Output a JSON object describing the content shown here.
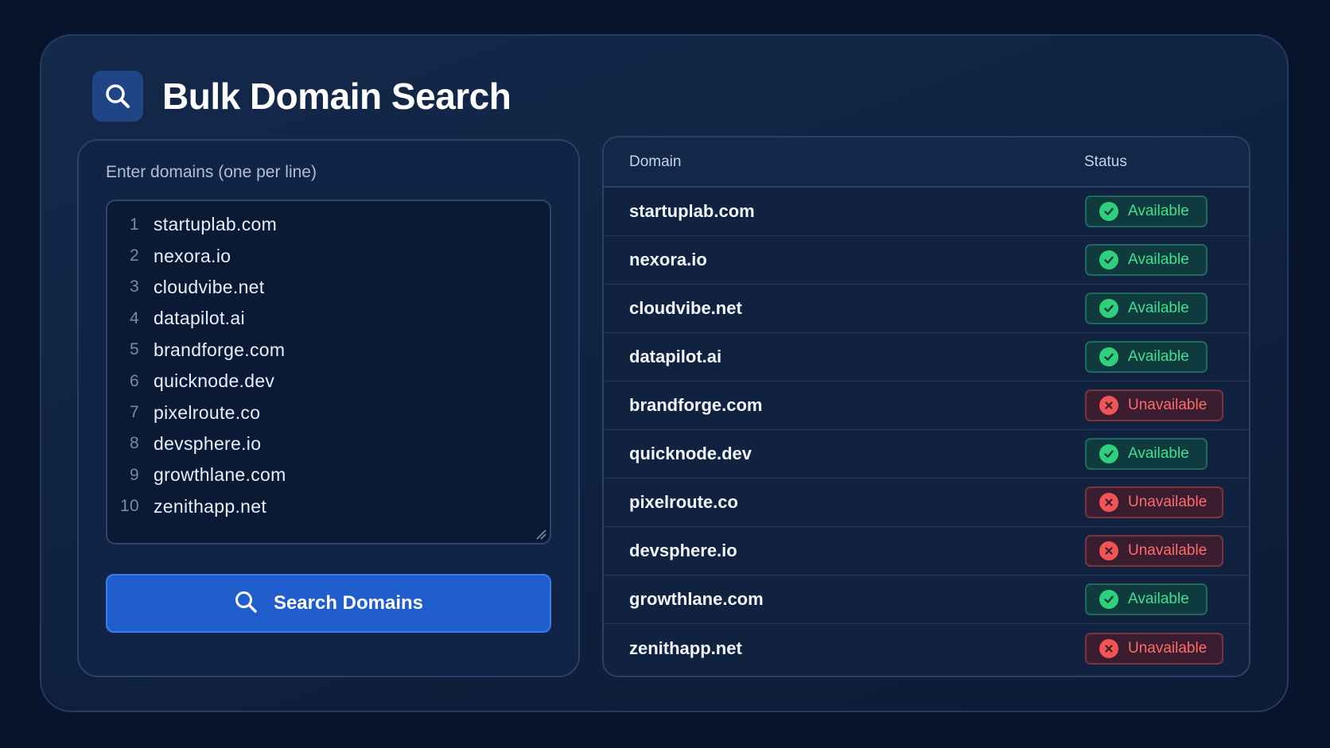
{
  "header": {
    "title": "Bulk Domain Search",
    "icon": "search-icon"
  },
  "input_panel": {
    "label": "Enter domains (one per line)",
    "lines": [
      {
        "num": "1",
        "text": "startuplab.com"
      },
      {
        "num": "2",
        "text": "nexora.io"
      },
      {
        "num": "3",
        "text": "cloudvibe.net"
      },
      {
        "num": "4",
        "text": "datapilot.ai"
      },
      {
        "num": "5",
        "text": "brandforge.com"
      },
      {
        "num": "6",
        "text": "quicknode.dev"
      },
      {
        "num": "7",
        "text": "pixelroute.co"
      },
      {
        "num": "8",
        "text": "devsphere.io"
      },
      {
        "num": "9",
        "text": "growthlane.com"
      },
      {
        "num": "10",
        "text": "zenithapp.net"
      }
    ],
    "button_label": "Search Domains",
    "button_icon": "search-icon"
  },
  "results": {
    "columns": {
      "domain": "Domain",
      "status": "Status"
    },
    "rows": [
      {
        "domain": "startuplab.com",
        "status": "Available",
        "state": "available"
      },
      {
        "domain": "nexora.io",
        "status": "Available",
        "state": "available"
      },
      {
        "domain": "cloudvibe.net",
        "status": "Available",
        "state": "available"
      },
      {
        "domain": "datapilot.ai",
        "status": "Available",
        "state": "available"
      },
      {
        "domain": "brandforge.com",
        "status": "Unavailable",
        "state": "unavailable"
      },
      {
        "domain": "quicknode.dev",
        "status": "Available",
        "state": "available"
      },
      {
        "domain": "pixelroute.co",
        "status": "Unavailable",
        "state": "unavailable"
      },
      {
        "domain": "devsphere.io",
        "status": "Unavailable",
        "state": "unavailable"
      },
      {
        "domain": "growthlane.com",
        "status": "Available",
        "state": "available"
      },
      {
        "domain": "zenithapp.net",
        "status": "Unavailable",
        "state": "unavailable"
      }
    ]
  },
  "colors": {
    "background": "#08142b",
    "accent": "#1f5ccc",
    "available": "#3fe08e",
    "unavailable": "#ff6b6b"
  }
}
